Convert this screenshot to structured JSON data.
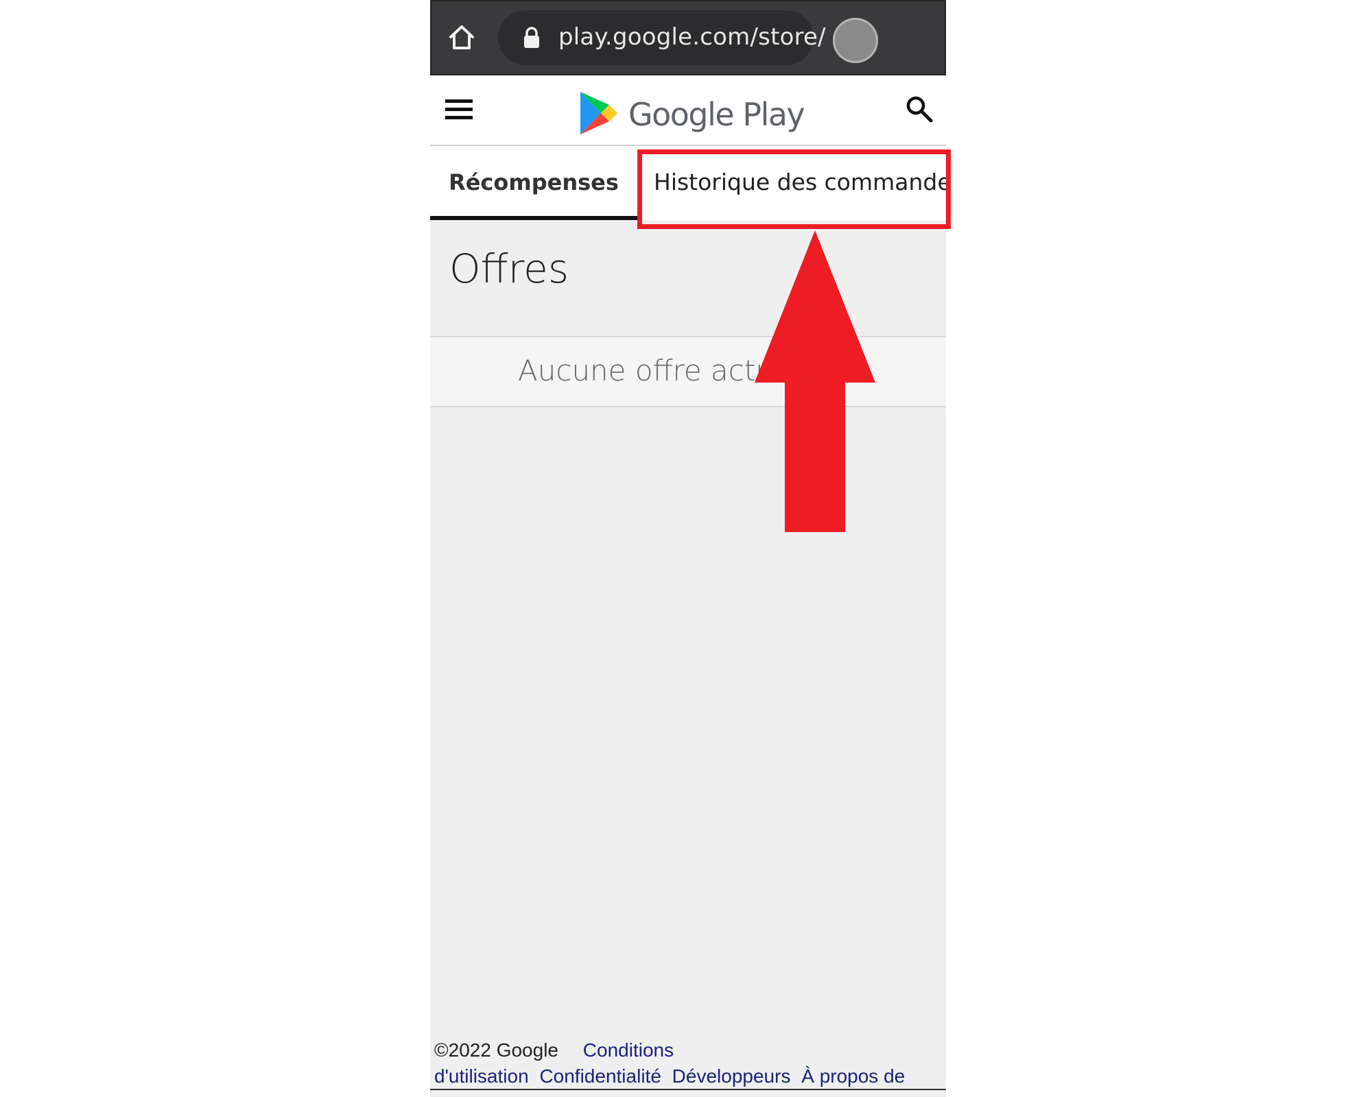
{
  "browser": {
    "url": "play.google.com/store/",
    "icons": {
      "home": "home-icon",
      "lock": "lock-icon",
      "avatar": "avatar"
    }
  },
  "header": {
    "brand": "Google Play",
    "icons": {
      "menu": "menu-icon",
      "search": "search-icon",
      "logo": "play-logo-icon"
    }
  },
  "tabs": [
    {
      "label": "Récompenses",
      "active": true
    },
    {
      "label": "Historique des commandes",
      "active": false
    }
  ],
  "main": {
    "title": "Offres",
    "empty_message": "Aucune offre actuel"
  },
  "footer": {
    "copyright": "©2022 Google",
    "links": [
      "Conditions d'utilisation",
      "Confidentialité",
      "Développeurs",
      "À propos de"
    ]
  },
  "colors": {
    "annotation_red": "#ee1c25",
    "browser_bar": "#3a3a3c",
    "link_blue": "#1a237e",
    "play_green": "#00c853",
    "play_blue": "#2196f3",
    "play_yellow": "#ffca28",
    "play_red": "#f44336"
  }
}
